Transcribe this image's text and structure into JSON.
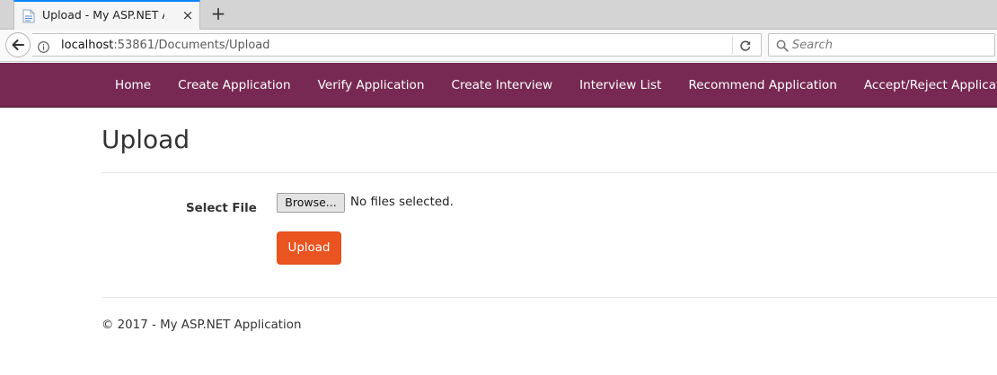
{
  "browser": {
    "tab": {
      "title": "Upload - My ASP.NET Applic",
      "favicon": "document-icon",
      "close": "×"
    },
    "new_tab": "+",
    "address": {
      "host": "localhost",
      "rest": ":53861/Documents/Upload"
    },
    "search": {
      "placeholder": "Search"
    }
  },
  "nav": {
    "items": [
      {
        "label": "Home"
      },
      {
        "label": "Create Application"
      },
      {
        "label": "Verify Application"
      },
      {
        "label": "Create Interview"
      },
      {
        "label": "Interview List"
      },
      {
        "label": "Recommend Application"
      },
      {
        "label": "Accept/Reject Application"
      }
    ],
    "background": "#772953"
  },
  "page": {
    "title": "Upload",
    "form": {
      "label": "Select File",
      "browse_label": "Browse...",
      "file_status": "No files selected.",
      "submit_label": "Upload",
      "submit_color": "#e95420"
    },
    "footer": "© 2017 - My ASP.NET Application"
  }
}
